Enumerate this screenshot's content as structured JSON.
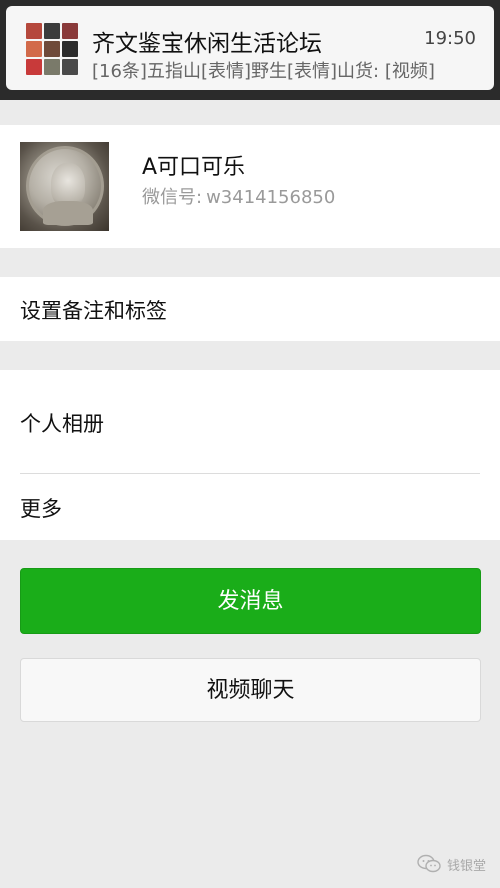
{
  "notification": {
    "title": "齐文鉴宝休闲生活论坛",
    "time": "19:50",
    "message": "[16条]五指山[表情]野生[表情]山货: [视频]",
    "avatar_tile_colors": [
      "#b5483c",
      "#3c3c3c",
      "#8a3a3a",
      "#d26a4a",
      "#6f4a3a",
      "#2c2c2c",
      "#c83a3a",
      "#7a7a6a",
      "#4a4a4a"
    ]
  },
  "profile": {
    "name": "A可口可乐",
    "wechat_label": "微信号:",
    "wechat_id": "w3414156850"
  },
  "menu": {
    "remark": "设置备注和标签",
    "album": "个人相册",
    "more": "更多"
  },
  "actions": {
    "send_message": "发消息",
    "video_chat": "视频聊天"
  },
  "watermark": {
    "text": "钱银堂"
  },
  "colors": {
    "background": "#ebebeb",
    "primary_button": "#1aad19"
  }
}
